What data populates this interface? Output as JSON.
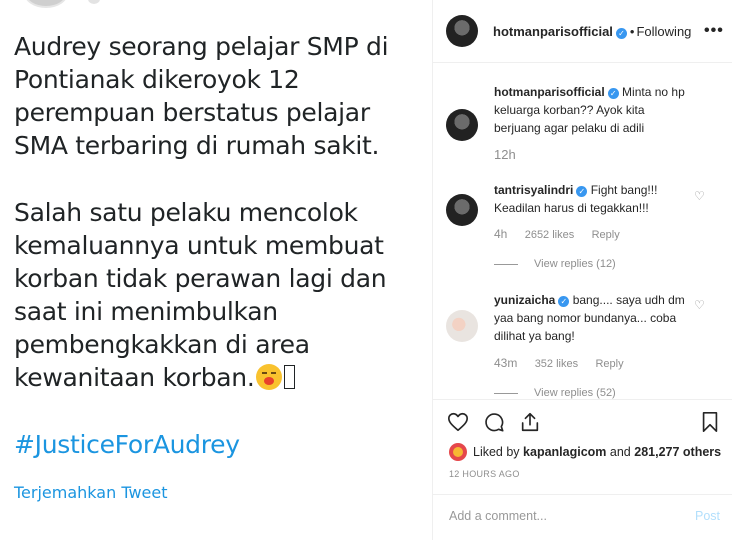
{
  "tweet": {
    "paragraph1": "Audrey seorang pelajar SMP di Pontianak dikeroyok 12 perempuan berstatus pelajar SMA terbaring di rumah sakit.",
    "paragraph2": "Salah satu pelaku mencolok kemaluannya untuk membuat korban tidak perawan lagi dan saat ini menimbulkan pembengkakkan di area kewanitaan korban.",
    "hashtag": "#JusticeForAudrey",
    "translate": "Terjemahkan Tweet"
  },
  "header": {
    "username": "hotmanparisofficial",
    "separator": "•",
    "follow_status": "Following",
    "more": "•••"
  },
  "comments": [
    {
      "username": "hotmanparisofficial",
      "text": "Minta no hp keluarga korban?? Ayok kita berjuang agar pelaku di adili",
      "time": "12h"
    },
    {
      "username": "tantrisyalindri",
      "text": "Fight bang!!! Keadilan harus di tegakkan!!!",
      "time": "4h",
      "likes": "2652 likes",
      "reply": "Reply",
      "view_replies": "View replies (12)"
    },
    {
      "username": "yunizaicha",
      "text": "bang.... saya udh dm yaa bang nomor bundanya... coba dilihat ya bang!",
      "time": "43m",
      "likes": "352 likes",
      "reply": "Reply",
      "view_replies": "View replies (52)"
    }
  ],
  "liked_by": {
    "prefix": "Liked by",
    "user": "kapanlagicom",
    "middle": "and",
    "count": "281,277 others"
  },
  "timestamp": "12 HOURS AGO",
  "add_comment": {
    "placeholder": "Add a comment...",
    "post_label": "Post"
  },
  "icons": [
    "heart-icon",
    "comment-icon",
    "share-icon",
    "bookmark-icon",
    "verified-icon",
    "more-icon"
  ],
  "colors": {
    "link_blue": "#1b95e0",
    "verified_blue": "#3897f0",
    "muted_text": "#8e8e8e",
    "post_button_disabled": "#b2dffc"
  }
}
